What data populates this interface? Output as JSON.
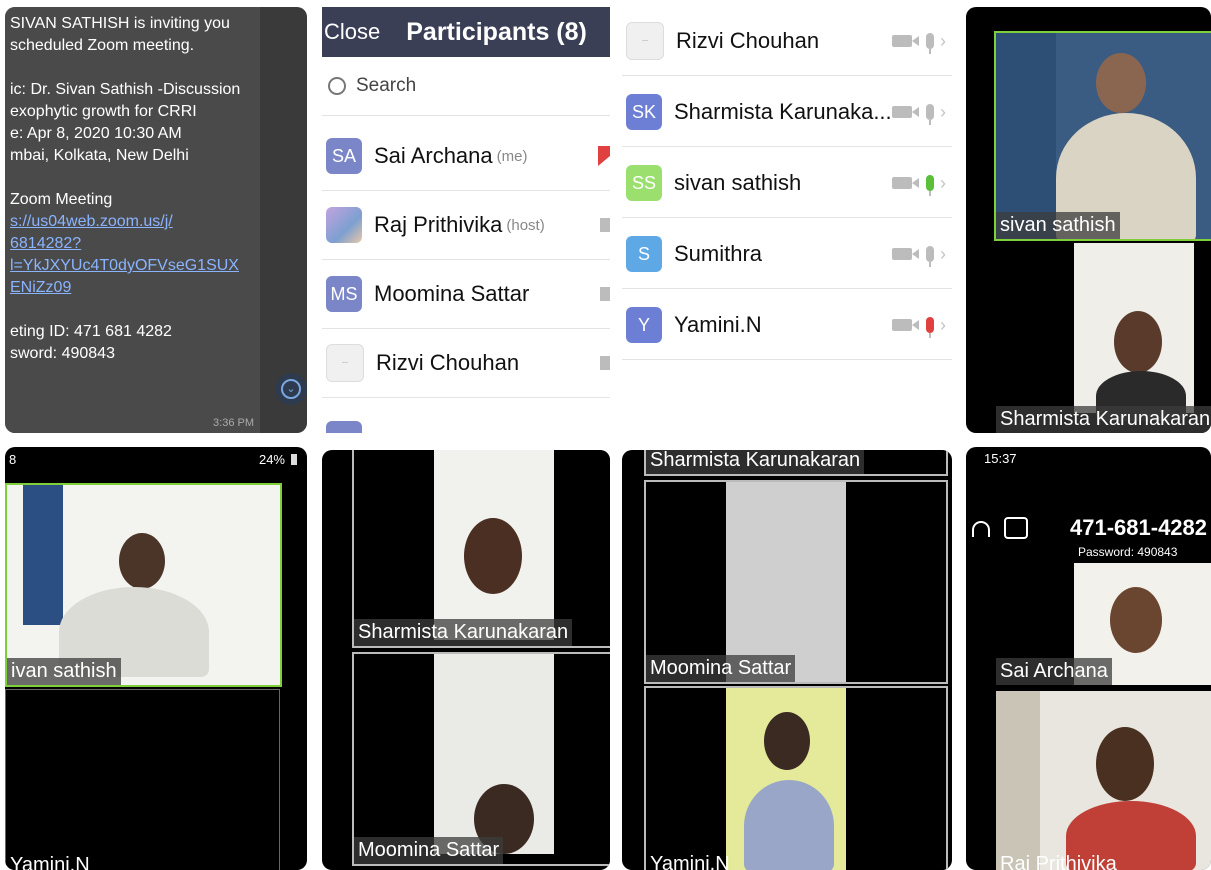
{
  "chat": {
    "lines": [
      "SIVAN SATHISH is inviting you",
      "scheduled Zoom meeting.",
      "",
      "ic: Dr. Sivan Sathish -Discussion",
      "exophytic growth for CRRI",
      "e: Apr 8, 2020 10:30 AM",
      "mbai, Kolkata, New Delhi",
      "",
      " Zoom Meeting",
      "s://us04web.zoom.us/j/",
      "6814282?",
      "l=YkJXYUc4T0dyOFVseG1SUX",
      "ENiZz09",
      "",
      "eting ID: 471 681 4282",
      "sword: 490843"
    ],
    "time": "3:36 PM"
  },
  "participants": {
    "close_label": "Close",
    "title": "Participants (8)",
    "search_placeholder": "Search",
    "items": [
      {
        "initials": "SA",
        "name": "Sai Archana",
        "tag": "(me)",
        "color": "#7b86c8"
      },
      {
        "initials": "",
        "name": "Raj Prithivika",
        "tag": "(host)",
        "color": "#b79ad1"
      },
      {
        "initials": "MS",
        "name": "Moomina Sattar",
        "tag": "",
        "color": "#7b86c8"
      },
      {
        "initials": "",
        "name": "Rizvi Chouhan",
        "tag": "",
        "color": "#eeeeee"
      }
    ]
  },
  "participants2": {
    "items": [
      {
        "initials": "",
        "name": "Rizvi Chouhan",
        "color": "#eeeeee"
      },
      {
        "initials": "SK",
        "name": "Sharmista Karunaka...",
        "color": "#6d7fd4"
      },
      {
        "initials": "SS",
        "name": "sivan sathish",
        "color": "#9be06f"
      },
      {
        "initials": "S",
        "name": "Sumithra",
        "color": "#5fa8e6"
      },
      {
        "initials": "Y",
        "name": "Yamini.N",
        "color": "#6d7fd4"
      }
    ]
  },
  "tiles": {
    "panel4_top": "sivan sathish",
    "panel4_bottom": "Sharmista Karunakaran",
    "panel5_top": "ivan sathish",
    "panel5_status": "8",
    "panel5_battery": "24%",
    "panel5_bottom": "Yamini.N",
    "panel6_top": "Sharmista Karunakaran",
    "panel6_bottom": "Moomina Sattar",
    "panel7_header": "Sharmista Karunakaran",
    "panel7_mid": "Moomina Sattar",
    "panel7_bottom": "Yamini.N",
    "panel8_time": "15:37",
    "panel8_meeting_id": "471-681-4282",
    "panel8_password": "Password: 490843",
    "panel8_mid": "Sai Archana",
    "panel8_bottom": "Raj Prithivika"
  }
}
